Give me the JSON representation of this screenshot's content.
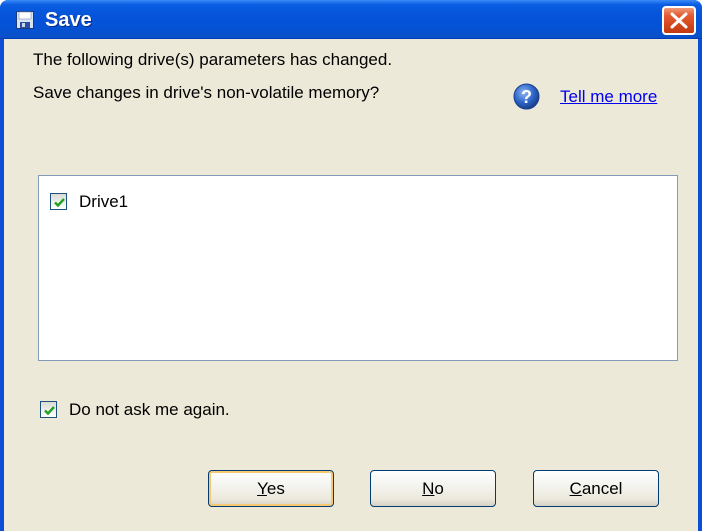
{
  "window": {
    "title": "Save",
    "icon": "floppy-disk-icon",
    "close_icon": "close-icon"
  },
  "message": {
    "line1": "The following drive(s) parameters has changed.",
    "line2": "Save changes in drive's non-volatile memory?"
  },
  "help": {
    "icon": "help-icon",
    "link_text": "Tell me more"
  },
  "drives": [
    {
      "label": "Drive1",
      "checked": true
    }
  ],
  "dont_ask": {
    "label": "Do not ask me again.",
    "checked": true
  },
  "buttons": {
    "yes": {
      "mnemonic": "Y",
      "rest": "es"
    },
    "no": {
      "mnemonic": "N",
      "rest": "o"
    },
    "cancel": {
      "mnemonic": "C",
      "rest": "ancel"
    }
  },
  "colors": {
    "titlebar": "#0553d8",
    "client_bg": "#ece9d8",
    "link": "#0000ee",
    "close_button": "#d2451c"
  }
}
